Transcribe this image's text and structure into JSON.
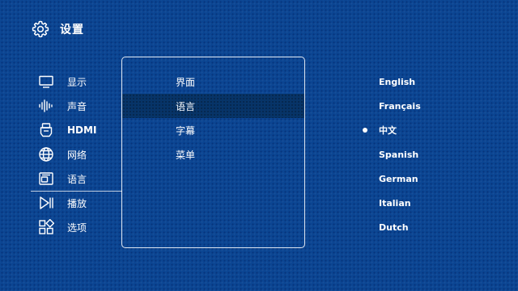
{
  "header": {
    "icon": "gear-icon",
    "title": "设置"
  },
  "sidebar": {
    "items": [
      {
        "label": "显示",
        "icon": "display-icon"
      },
      {
        "label": "声音",
        "icon": "sound-icon"
      },
      {
        "label": "HDMI",
        "icon": "hdmi-icon"
      },
      {
        "label": "网络",
        "icon": "network-icon"
      },
      {
        "label": "语言",
        "icon": "language-icon"
      },
      {
        "label": "播放",
        "icon": "playback-icon",
        "selected": true
      },
      {
        "label": "选项",
        "icon": "options-icon"
      }
    ]
  },
  "submenu": {
    "items": [
      {
        "label": "界面"
      },
      {
        "label": "语言",
        "highlighted": true
      },
      {
        "label": "字幕"
      },
      {
        "label": "菜单"
      }
    ]
  },
  "languages": {
    "items": [
      {
        "label": "English"
      },
      {
        "label": "Français"
      },
      {
        "label": "中文",
        "selected": true
      },
      {
        "label": "Spanish"
      },
      {
        "label": "German"
      },
      {
        "label": "Italian"
      },
      {
        "label": "Dutch"
      }
    ]
  },
  "colors": {
    "background": "#0b4592",
    "highlight": "#073468",
    "text": "#ffffff"
  }
}
